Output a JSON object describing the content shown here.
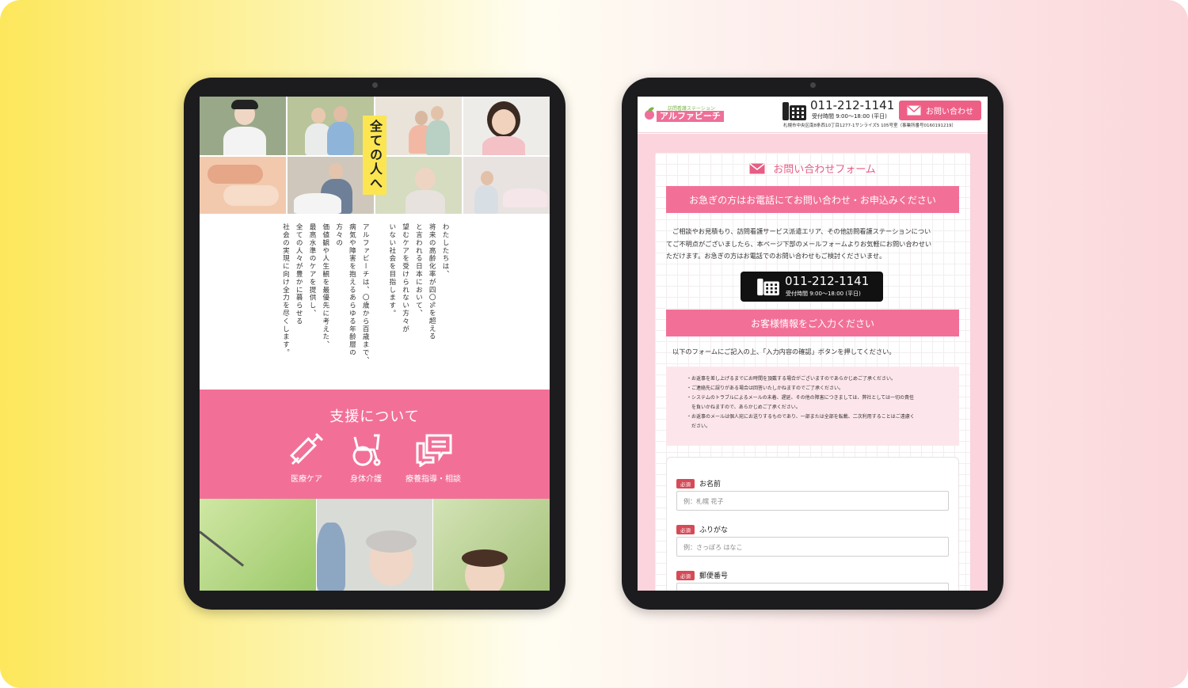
{
  "left_tablet": {
    "hero_badge": "全ての人へ",
    "intro_paragraphs": [
      "わたしたちは、",
      "将来の高齢化率が四〇%を超える",
      "と言われる日本において、",
      "望むケアを受けられない方々が",
      "いない社会を目指します。",
      "",
      "アルファビーチは、〇歳から百歳まで、",
      "病気や障害を抱えるあらゆる年齢層の方々の",
      "価値観や人生観を最優先に考えた、",
      "最高水準のケアを提供し、",
      "全ての人々が豊かに暮らせる",
      "社会の実現に向け全力を尽くします。"
    ],
    "support_title": "支援について",
    "services": [
      {
        "label": "医療ケア",
        "icon": "syringe-icon"
      },
      {
        "label": "身体介護",
        "icon": "wheelchair-icon"
      },
      {
        "label": "療養指導・相談",
        "icon": "chat-bubbles-icon"
      }
    ],
    "accent": "#f27098",
    "badge_color": "#fbe651"
  },
  "right_tablet": {
    "header": {
      "logo_tagline": "訪問看護ステーション",
      "logo_name": "アルファビーチ",
      "phone": "011-212-1141",
      "hours": "受付時間 9:00〜18:00 (平日)",
      "address": "札幌市中央区南8条西10丁目1277-1サンライズ5 105号室（事業所番号0160191219）",
      "contact_button": "お問い合わせ"
    },
    "form_title": "お問い合わせフォーム",
    "urgent_bar": "お急ぎの方はお電話にてお問い合わせ・お申込みください",
    "intro_lines": [
      "ご相談やお見積もり、訪問看護サービス派遣エリア、その他訪問看護ステーションについ",
      "てご不明点がございましたら、本ページ下部のメールフォームよりお気軽にお問い合わせい",
      "ただけます。お急ぎの方はお電話でのお問い合わせもご検討くださいませ。"
    ],
    "tel_button": {
      "number": "011-212-1141",
      "hours": "受付時間 9:00〜18:00 (平日)"
    },
    "customer_bar": "お客様情報をご入力ください",
    "instruction": "以下のフォームにご記入の上、「入力内容の確認」ボタンを押してください。",
    "notes": [
      "・お返事を差し上げるまでにお時間を頂戴する場合がございますのであらかじめご了承ください。",
      "・ご連絡先に誤りがある場合は回答いたしかねますのでご了承ください。",
      "・システムのトラブルによるメールの未着、遅延、その他の障害につきましては、弊社としては一切の責任",
      "　を負いかねますので、あらかじめご了承ください。",
      "・お返事のメールは個人宛にお送りするものであり、一部または全部を転載、二次利用することはご遠慮く",
      "　ださい。"
    ],
    "fields": [
      {
        "required": "必須",
        "label": "お名前",
        "placeholder": "例：札幌 花子"
      },
      {
        "required": "必須",
        "label": "ふりがな",
        "placeholder": "例：さっぽろ はなこ"
      },
      {
        "required": "必須",
        "label": "郵便番号",
        "placeholder": ""
      }
    ],
    "accent": "#ee5f86"
  }
}
